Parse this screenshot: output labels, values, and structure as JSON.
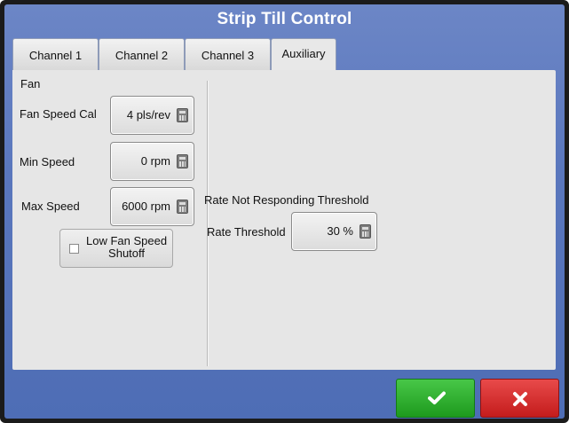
{
  "window": {
    "title": "Strip Till Control"
  },
  "tabs": [
    {
      "label": "Channel 1",
      "active": false
    },
    {
      "label": "Channel 2",
      "active": false
    },
    {
      "label": "Channel 3",
      "active": false
    },
    {
      "label": "Auxiliary",
      "active": true
    }
  ],
  "fan": {
    "section_label": "Fan",
    "speed_cal": {
      "label": "Fan Speed Cal",
      "value": "4 pls/rev"
    },
    "min_speed": {
      "label": "Min Speed",
      "value": "0 rpm"
    },
    "max_speed": {
      "label": "Max Speed",
      "value": "6000 rpm"
    },
    "low_speed_shutoff": {
      "label_line1": "Low Fan Speed",
      "label_line2": "Shutoff",
      "checked": false
    }
  },
  "rate": {
    "section_label": "Rate Not Responding Threshold",
    "threshold": {
      "label": "Rate Threshold",
      "value": "30 %"
    }
  },
  "footer": {
    "ok_icon": "checkmark-icon",
    "cancel_icon": "x-icon",
    "colors": {
      "ok": "#2eae2e",
      "cancel": "#d42a2a"
    }
  },
  "icons": {
    "calculator": "calculator-icon"
  }
}
